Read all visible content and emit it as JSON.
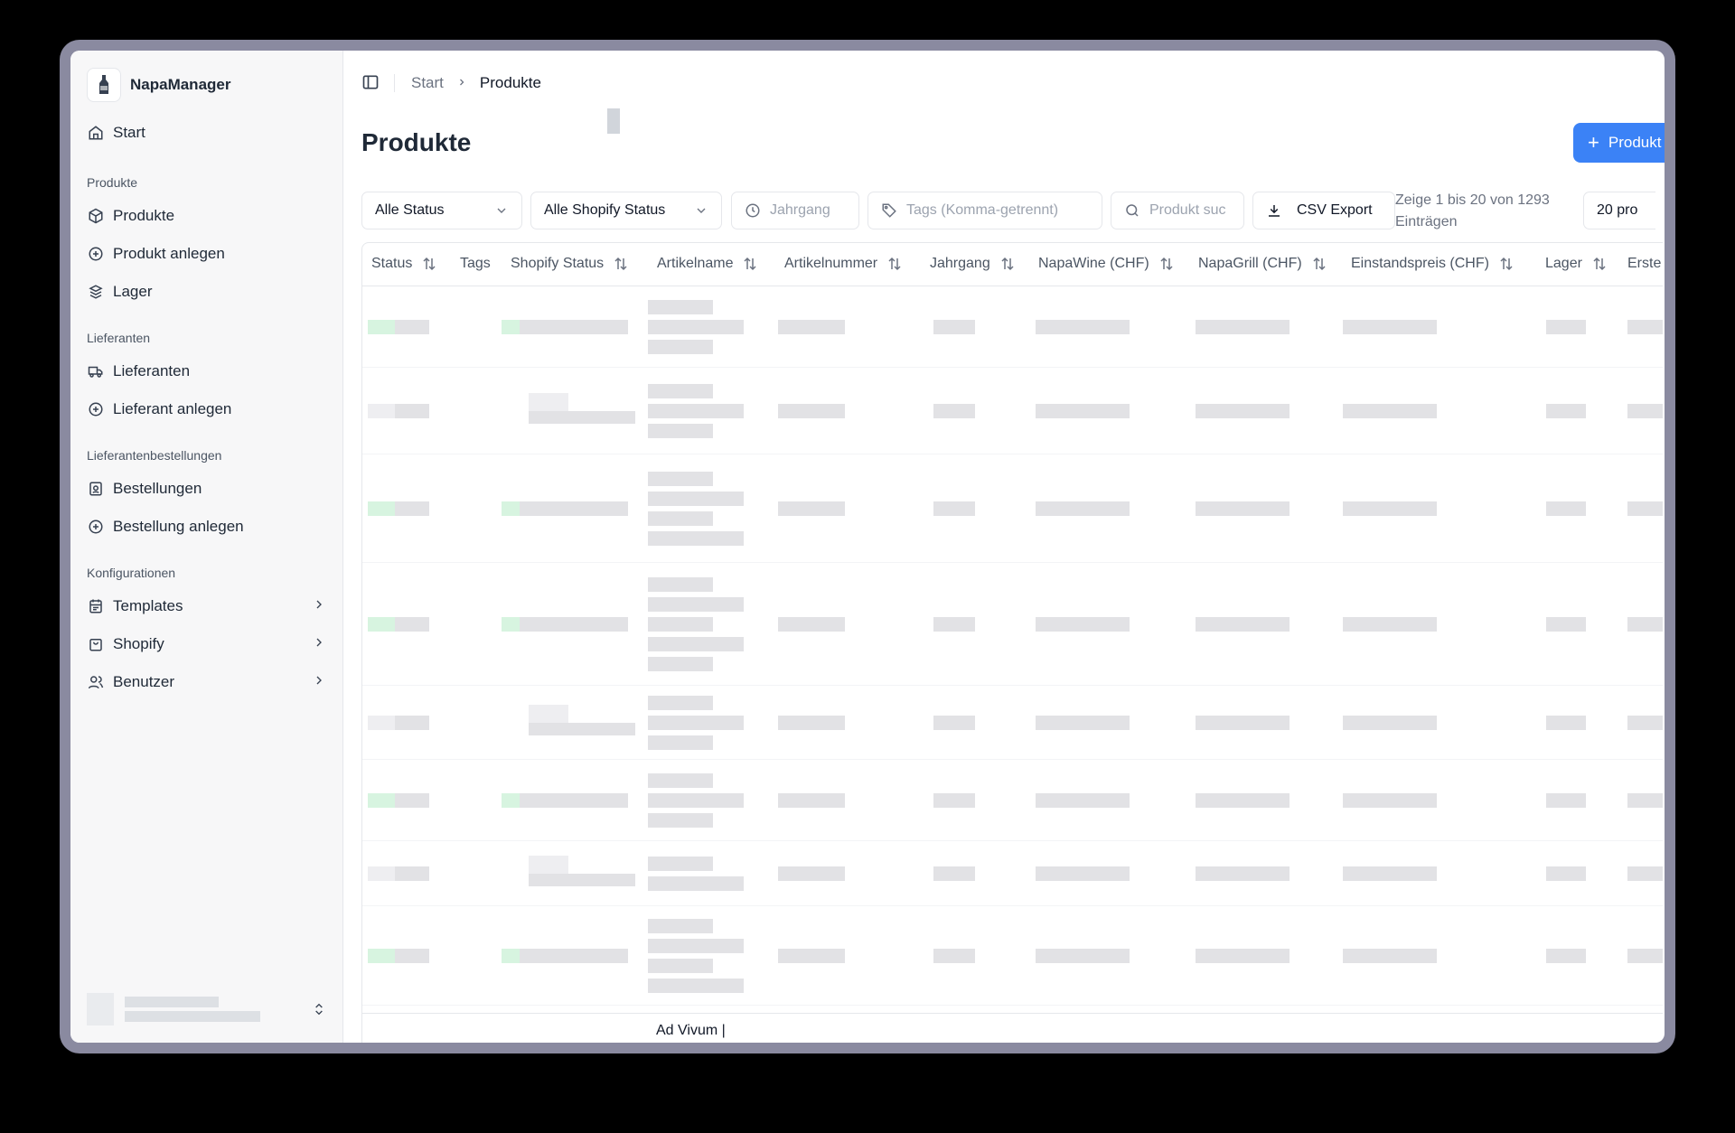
{
  "app": {
    "name": "NapaManager"
  },
  "sidebar": {
    "start": "Start",
    "sections": [
      {
        "label": "Produkte",
        "items": [
          "Produkte",
          "Produkt anlegen",
          "Lager"
        ]
      },
      {
        "label": "Lieferanten",
        "items": [
          "Lieferanten",
          "Lieferant anlegen"
        ]
      },
      {
        "label": "Lieferantenbestellungen",
        "items": [
          "Bestellungen",
          "Bestellung anlegen"
        ]
      },
      {
        "label": "Konfigurationen",
        "items": [
          "Templates",
          "Shopify",
          "Benutzer"
        ]
      }
    ]
  },
  "breadcrumb": {
    "home": "Start",
    "current": "Produkte"
  },
  "page": {
    "title": "Produkte",
    "new_button": "Produkt"
  },
  "filters": {
    "status": "Alle Status",
    "shopify_status": "Alle Shopify Status",
    "jahrgang_placeholder": "Jahrgang",
    "tags_placeholder": "Tags (Komma-getrennt)",
    "search_placeholder": "Produkt suc",
    "csv_export": "CSV Export",
    "entries_info": "Zeige 1 bis 20 von 1293 Einträgen",
    "page_size": "20 pro"
  },
  "table": {
    "columns": [
      "Status",
      "Tags",
      "Shopify Status",
      "Artikelname",
      "Artikelnummer",
      "Jahrgang",
      "NapaWine (CHF)",
      "NapaGrill (CHF)",
      "Einstandspreis (CHF)",
      "Lager",
      "Erste"
    ],
    "footer_text": "Ad Vivum |"
  },
  "colors": {
    "primary": "#3b82f6",
    "active_status": "#c9f0d6"
  }
}
